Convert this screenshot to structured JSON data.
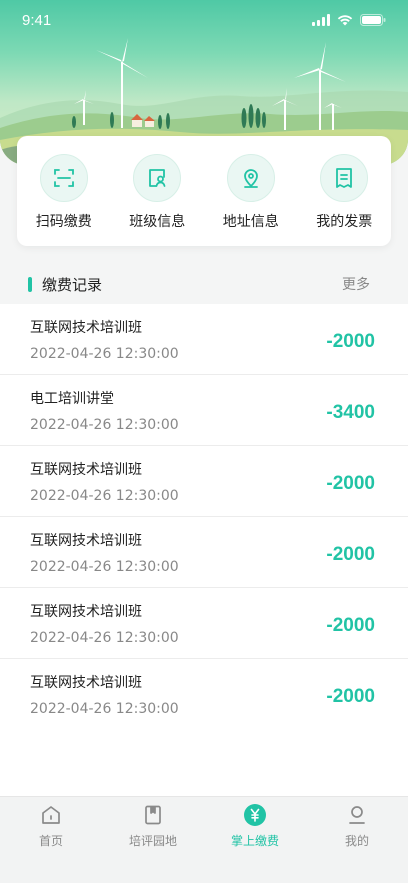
{
  "status_bar": {
    "time": "9:41"
  },
  "colors": {
    "accent": "#21c3a5",
    "hero_top": "#4fc9a5",
    "hero_bottom": "#d9edc4",
    "text_primary": "#222222",
    "text_secondary": "#888888",
    "tab_inactive": "#8a8a8a",
    "background": "#f4f5f5"
  },
  "quick_actions": [
    {
      "label": "扫码缴费",
      "icon": "scan-icon"
    },
    {
      "label": "班级信息",
      "icon": "class-info-icon"
    },
    {
      "label": "地址信息",
      "icon": "location-pin-icon"
    },
    {
      "label": "我的发票",
      "icon": "invoice-icon"
    }
  ],
  "records": {
    "title": "缴费记录",
    "more_label": "更多",
    "items": [
      {
        "name": "互联网技术培训班",
        "time": "2022-04-26  12:30:00",
        "amount": "-2000"
      },
      {
        "name": "电工培训讲堂",
        "time": "2022-04-26  12:30:00",
        "amount": "-3400"
      },
      {
        "name": "互联网技术培训班",
        "time": "2022-04-26  12:30:00",
        "amount": "-2000"
      },
      {
        "name": "互联网技术培训班",
        "time": "2022-04-26  12:30:00",
        "amount": "-2000"
      },
      {
        "name": "互联网技术培训班",
        "time": "2022-04-26  12:30:00",
        "amount": "-2000"
      },
      {
        "name": "互联网技术培训班",
        "time": "2022-04-26  12:30:00",
        "amount": "-2000"
      }
    ]
  },
  "tab_bar": {
    "active_index": 2,
    "tabs": [
      {
        "label": "首页",
        "icon": "home-icon"
      },
      {
        "label": "培评园地",
        "icon": "book-icon"
      },
      {
        "label": "掌上缴费",
        "icon": "yuan-payment-icon"
      },
      {
        "label": "我的",
        "icon": "user-icon"
      }
    ]
  }
}
